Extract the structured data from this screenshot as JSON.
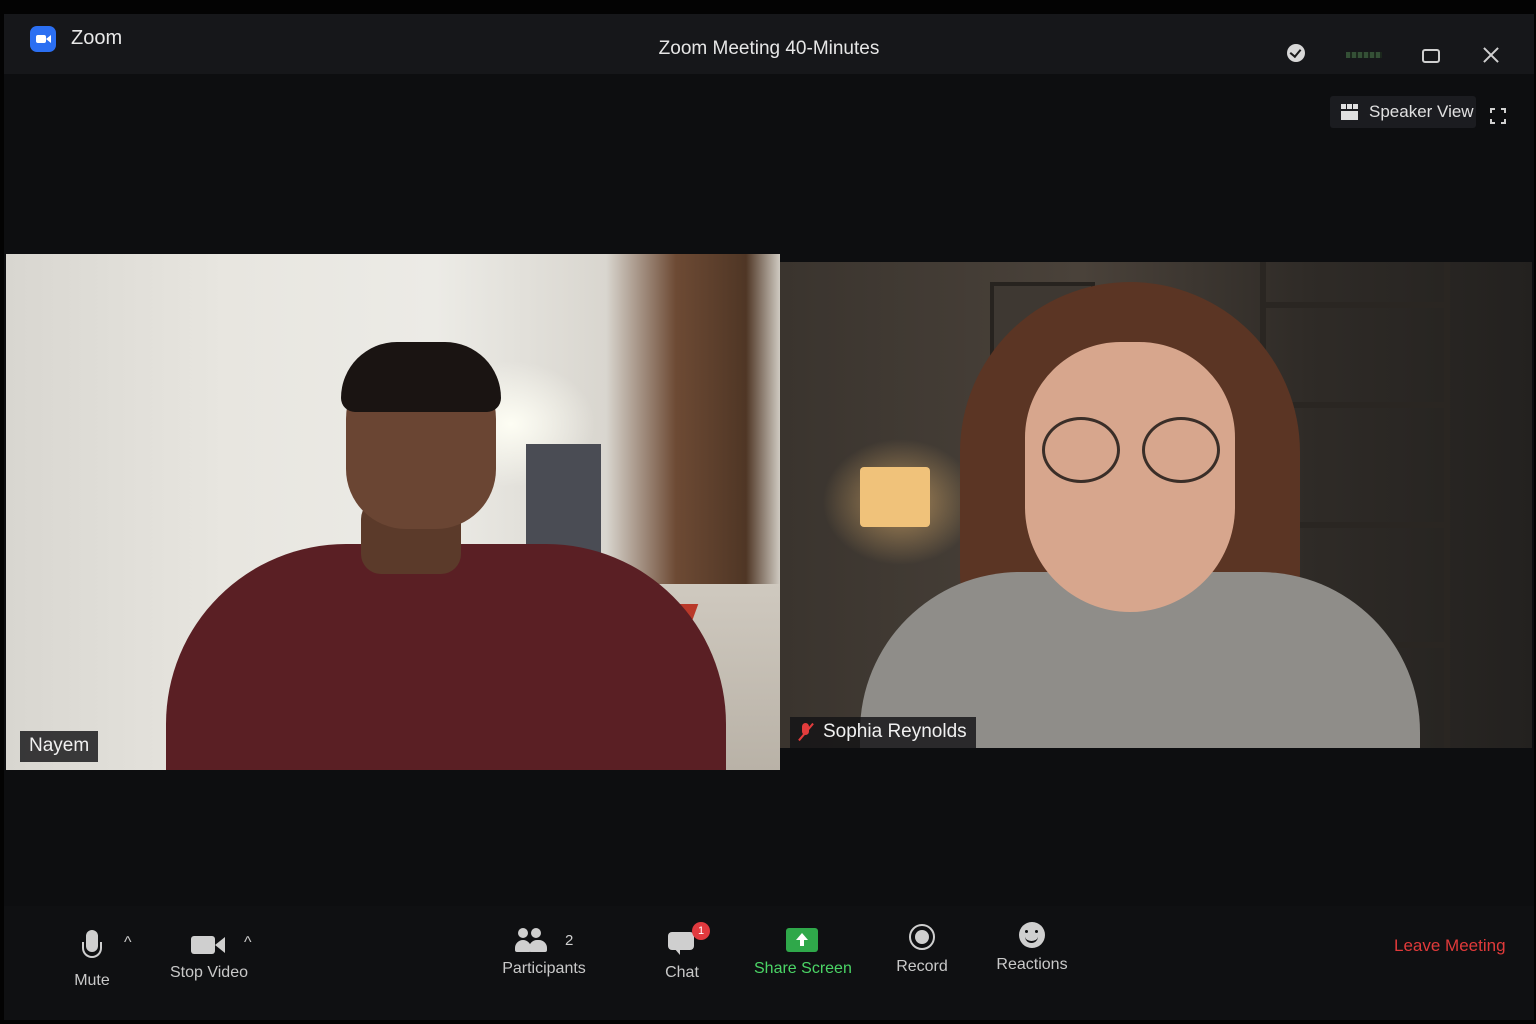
{
  "app": {
    "name": "Zoom",
    "meeting_title": "Zoom Meeting 40-Minutes"
  },
  "view": {
    "speaker_view_label": "Speaker View"
  },
  "participants": [
    {
      "name": "Nayem",
      "muted": false
    },
    {
      "name": "Sophia Reynolds",
      "muted": true
    }
  ],
  "toolbar": {
    "mute_label": "Mute",
    "stop_video_label": "Stop Video",
    "participants_label": "Participants",
    "participants_count": "2",
    "chat_label": "Chat",
    "chat_badge": "1",
    "share_label": "Share Screen",
    "record_label": "Record",
    "reactions_label": "Reactions",
    "leave_label": "Leave Meeting",
    "caret": "^"
  },
  "colors": {
    "brand": "#2b6ff2",
    "share": "#4bd566",
    "leave": "#e03a3a",
    "badge": "#e0393e"
  },
  "icons": [
    "zoom-logo-icon",
    "check-icon",
    "minimize-icon",
    "maximize-icon",
    "close-icon",
    "grid-icon",
    "fullscreen-icon",
    "mic-icon",
    "video-icon",
    "participants-icon",
    "chat-icon",
    "share-screen-icon",
    "record-icon",
    "reactions-icon",
    "muted-mic-icon"
  ]
}
